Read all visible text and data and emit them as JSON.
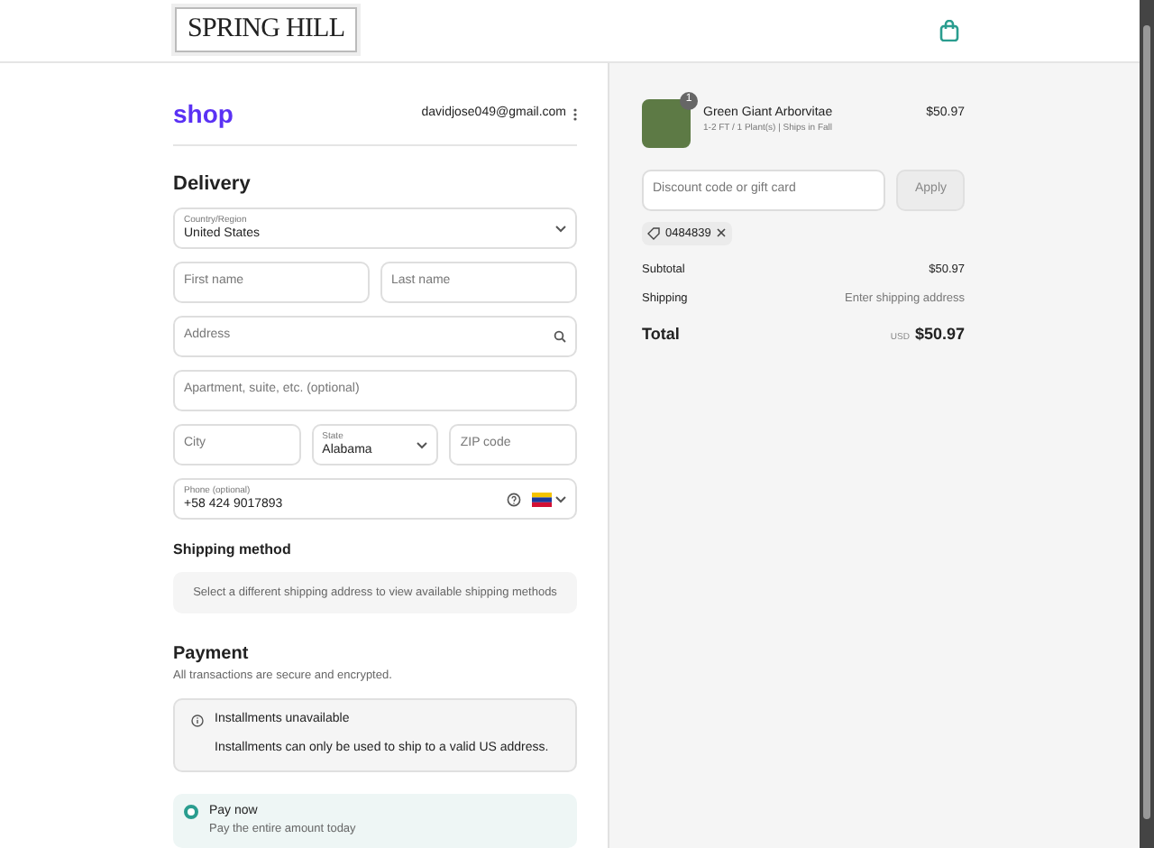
{
  "header": {
    "logo": "SPRING HILL"
  },
  "account": {
    "brand": "shop",
    "email": "davidjose049@gmail.com"
  },
  "delivery": {
    "title": "Delivery",
    "fields": [
      {
        "kind": "select",
        "label": "Country/Region",
        "value": "United States"
      },
      {
        "kind": "row",
        "items": [
          {
            "kind": "text",
            "placeholder": "First name"
          },
          {
            "kind": "text",
            "placeholder": "Last name"
          }
        ]
      },
      {
        "kind": "search",
        "placeholder": "Address"
      },
      {
        "kind": "text",
        "placeholder": "Apartment, suite, etc. (optional)"
      },
      {
        "kind": "row",
        "items": [
          {
            "kind": "text",
            "placeholder": "City"
          },
          {
            "kind": "select",
            "label": "State",
            "value": "Alabama"
          },
          {
            "kind": "text",
            "placeholder": "ZIP code"
          }
        ]
      },
      {
        "kind": "phone",
        "label": "Phone (optional)",
        "value": "+58 424 9017893"
      }
    ]
  },
  "shipping_method": {
    "title": "Shipping method",
    "notice": "Select a different shipping address to view available shipping methods"
  },
  "payment": {
    "title": "Payment",
    "subtitle": "All transactions are secure and encrypted.",
    "alert": {
      "title": "Installments unavailable",
      "text": "Installments can only be used to ship to a valid US address."
    },
    "options": [
      {
        "label": "Pay now",
        "description": "Pay the entire amount today",
        "selected": true
      }
    ]
  },
  "summary": {
    "items": [
      {
        "quantity": "1",
        "name": "Green Giant Arborvitae",
        "variant": "1-2 FT / 1 Plant(s) | Ships in Fall",
        "price": "$50.97"
      }
    ],
    "discount": {
      "placeholder": "Discount code or gift card",
      "button": "Apply",
      "code": "0484839"
    },
    "lines": [
      {
        "label": "Subtotal",
        "value": "$50.97"
      },
      {
        "label": "Shipping",
        "value": "Enter shipping address"
      }
    ],
    "total": {
      "label": "Total",
      "currency": "USD",
      "value": "$50.97"
    }
  }
}
